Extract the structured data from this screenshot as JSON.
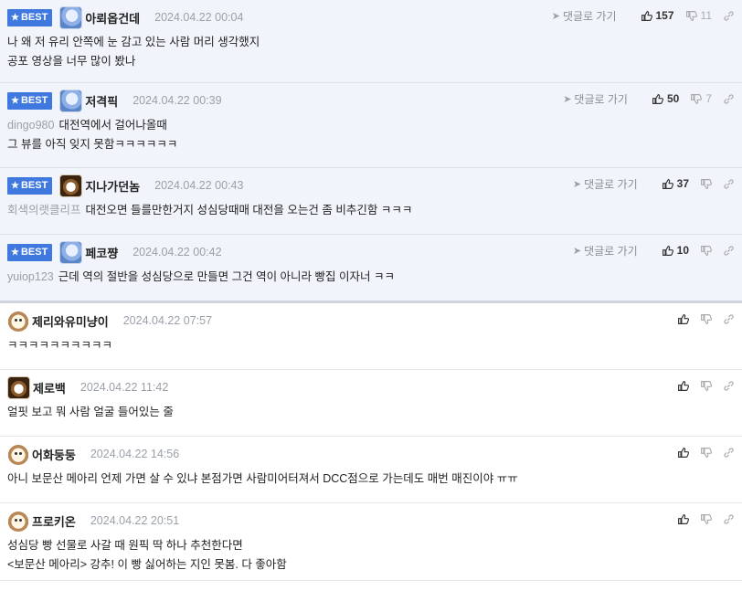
{
  "labels": {
    "best": "BEST",
    "reply": "댓글로 가기"
  },
  "comments": [
    {
      "best": true,
      "avatar": "bird-avatar",
      "nick": "아뢰옵건데",
      "date": "2024.04.22 00:04",
      "likes": "157",
      "dislikes": "11",
      "mention": "",
      "lines": [
        "나 왜 저 유리 안쪽에 눈 감고 있는 사람 머리 생각했지",
        "공포 영상을 너무 많이 봤나"
      ]
    },
    {
      "best": true,
      "avatar": "bird-avatar",
      "nick": "저격픽",
      "date": "2024.04.22 00:39",
      "likes": "50",
      "dislikes": "7",
      "mention": "dingo980",
      "lines": [
        "대전역에서 걸어나올때",
        "그 뷰를 아직 잊지 못함ㅋㅋㅋㅋㅋㅋ"
      ]
    },
    {
      "best": true,
      "avatar": "dog-avatar",
      "nick": "지나가던놈",
      "date": "2024.04.22 00:43",
      "likes": "37",
      "dislikes": "",
      "mention": "회색의랫클리프",
      "lines": [
        "대전오면 들를만한거지 성심당때매 대전을 오는건 좀 비추긴함 ㅋㅋㅋ"
      ]
    },
    {
      "best": true,
      "avatar": "bird-avatar",
      "nick": "페코쨩",
      "date": "2024.04.22 00:42",
      "likes": "10",
      "dislikes": "",
      "mention": "yuiop123",
      "lines": [
        "근데 역의 절반을 성심당으로 만들면 그건 역이 아니라 빵집 이자너 ㅋㅋ"
      ]
    },
    {
      "best": false,
      "avatar": "puppy-avatar",
      "nick": "제리와유미냥이",
      "date": "2024.04.22 07:57",
      "likes": "",
      "dislikes": "",
      "mention": "",
      "lines": [
        "ㅋㅋㅋㅋㅋㅋㅋㅋㅋㅋ"
      ]
    },
    {
      "best": false,
      "avatar": "dog-avatar",
      "nick": "제로백",
      "date": "2024.04.22 11:42",
      "likes": "",
      "dislikes": "",
      "mention": "",
      "lines": [
        "얼핏 보고 뭐 사람 얼굴 들어있는 줄"
      ]
    },
    {
      "best": false,
      "avatar": "puppy-avatar",
      "nick": "어화둥둥",
      "date": "2024.04.22 14:56",
      "likes": "",
      "dislikes": "",
      "mention": "",
      "lines": [
        "아니 보문산 메아리 언제 가면 살 수 있냐 본점가면 사람미어터져서 DCC점으로 가는데도 매번 매진이야 ㅠㅠ"
      ]
    },
    {
      "best": false,
      "avatar": "puppy-avatar",
      "nick": "프로키온",
      "date": "2024.04.22 20:51",
      "likes": "",
      "dislikes": "",
      "mention": "",
      "lines": [
        "성심당 빵 선물로 사갈 때 원픽 딱 하나 추천한다면",
        "<보문산 메아리> 강추! 이 빵 싫어하는 지인 못봄. 다 좋아함"
      ]
    }
  ]
}
